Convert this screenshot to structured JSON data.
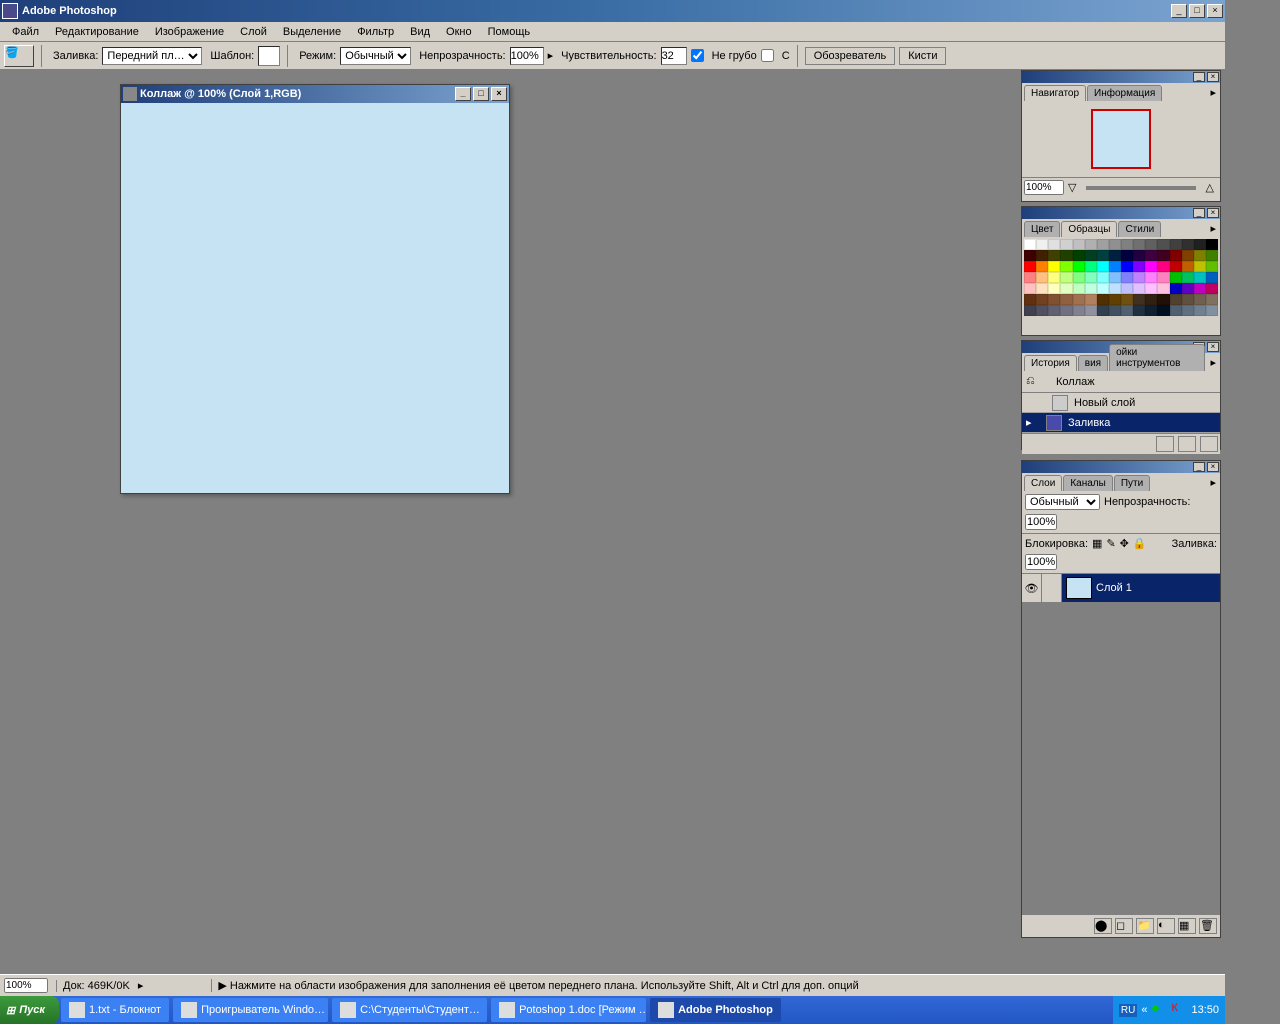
{
  "app": {
    "title": "Adobe Photoshop"
  },
  "menu": [
    "Файл",
    "Редактирование",
    "Изображение",
    "Слой",
    "Выделение",
    "Фильтр",
    "Вид",
    "Окно",
    "Помощь"
  ],
  "options": {
    "fill_label": "Заливка:",
    "fill_value": "Передний пл…",
    "pattern_label": "Шаблон:",
    "mode_label": "Режим:",
    "mode_value": "Обычный",
    "opacity_label": "Непрозрачность:",
    "opacity_value": "100%",
    "tolerance_label": "Чувствительность:",
    "tolerance_value": "32",
    "antialias_label": "Не грубо",
    "contiguous_label": "С",
    "browser_tab": "Обозреватель",
    "brushes_tab": "Кисти"
  },
  "document": {
    "title": "Коллаж @ 100% (Слой 1,RGB)"
  },
  "navigator": {
    "tab1": "Навигатор",
    "tab2": "Информация",
    "zoom": "100%"
  },
  "swatches": {
    "tab1": "Цвет",
    "tab2": "Образцы",
    "tab3": "Стили"
  },
  "history": {
    "tab1": "История",
    "tab2": "вия",
    "tab3": "ойки инструментов",
    "snapshot": "Коллаж",
    "items": [
      "Новый слой",
      "Заливка"
    ]
  },
  "layers": {
    "tab1": "Слои",
    "tab2": "Каналы",
    "tab3": "Пути",
    "blend_value": "Обычный",
    "opacity_label": "Непрозрачность:",
    "opacity_value": "100%",
    "lock_label": "Блокировка:",
    "fill_label": "Заливка:",
    "fill_value": "100%",
    "layer1": "Слой 1"
  },
  "status": {
    "zoom": "100%",
    "doc": "Док: 469K/0K",
    "hint": "Нажмите на области изображения для заполнения её цветом переднего плана. Используйте Shift, Alt и Ctrl для доп. опций"
  },
  "taskbar": {
    "start": "Пуск",
    "tasks": [
      "1.txt - Блокнот",
      "Проигрыватель Windo…",
      "С:\\Студенты\\Студент…",
      "Potoshop 1.doc [Режим …",
      "Adobe Photoshop"
    ],
    "lang": "RU",
    "time": "13:50"
  },
  "swatch_colors": [
    "#ffffff",
    "#f0f0f0",
    "#e0e0e0",
    "#d0d0d0",
    "#c0c0c0",
    "#b0b0b0",
    "#a0a0a0",
    "#909090",
    "#808080",
    "#707070",
    "#606060",
    "#505050",
    "#404040",
    "#303030",
    "#202020",
    "#000000",
    "#400000",
    "#402000",
    "#404000",
    "#204000",
    "#004000",
    "#004020",
    "#004040",
    "#002040",
    "#000040",
    "#200040",
    "#400040",
    "#400020",
    "#800000",
    "#804000",
    "#808000",
    "#408000",
    "#ff0000",
    "#ff8000",
    "#ffff00",
    "#80ff00",
    "#00ff00",
    "#00ff80",
    "#00ffff",
    "#0080ff",
    "#0000ff",
    "#8000ff",
    "#ff00ff",
    "#ff0080",
    "#c00000",
    "#c06000",
    "#c0c000",
    "#60c000",
    "#ff8080",
    "#ffc080",
    "#ffff80",
    "#c0ff80",
    "#80ff80",
    "#80ffc0",
    "#80ffff",
    "#80c0ff",
    "#8080ff",
    "#c080ff",
    "#ff80ff",
    "#ff80c0",
    "#00c000",
    "#00c060",
    "#00c0c0",
    "#0060c0",
    "#ffc0c0",
    "#ffe0c0",
    "#ffffc0",
    "#e0ffc0",
    "#c0ffc0",
    "#c0ffe0",
    "#c0ffff",
    "#c0e0ff",
    "#c0c0ff",
    "#e0c0ff",
    "#ffc0ff",
    "#ffc0e0",
    "#0000c0",
    "#6000c0",
    "#c000c0",
    "#c00060",
    "#603010",
    "#704020",
    "#805030",
    "#906040",
    "#a07050",
    "#b08060",
    "#503000",
    "#604000",
    "#705010",
    "#403020",
    "#302010",
    "#201008",
    "#504030",
    "#605040",
    "#706050",
    "#807060",
    "#404050",
    "#505060",
    "#606070",
    "#707080",
    "#808090",
    "#9090a0",
    "#304050",
    "#405060",
    "#506070",
    "#203040",
    "#102030",
    "#001020",
    "#506070",
    "#607080",
    "#708090",
    "#8090a0"
  ]
}
